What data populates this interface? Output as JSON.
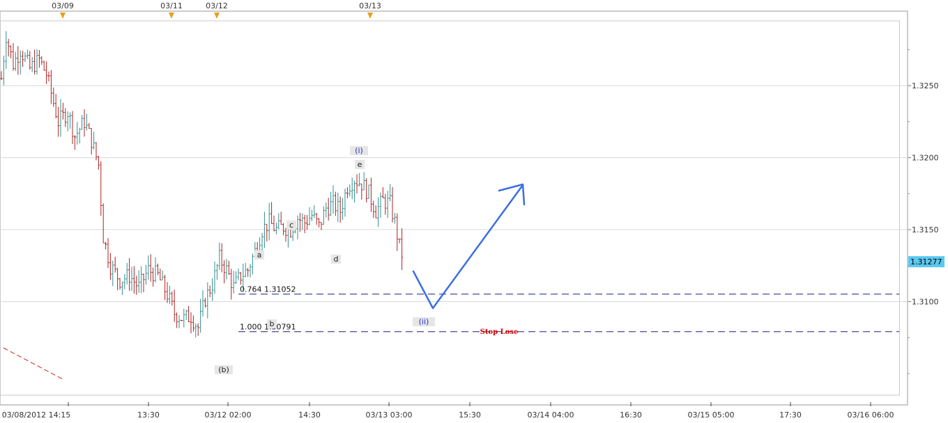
{
  "chart_data": {
    "type": "ohlc",
    "y_axis": {
      "ylim": [
        1.3035,
        1.3295
      ],
      "ticks": [
        1.31,
        1.315,
        1.32,
        1.325
      ],
      "tick_labels": [
        "1.3100",
        "1.3150",
        "1.3200",
        "1.3250"
      ]
    },
    "x_axis": {
      "tick_labels": [
        "03/08/2012 14:15",
        "13:30",
        "03/12 02:00",
        "14:30",
        "03/13 03:00",
        "15:30",
        "03/14 04:00",
        "16:30",
        "03/15 05:00",
        "17:30",
        "03/16 06:00"
      ]
    },
    "session_markers": [
      "03/09",
      "03/11",
      "03/12",
      "03/13"
    ],
    "current_price": {
      "value": 1.31277,
      "label": "1.31277"
    },
    "price_path": [
      [
        0,
        1.3255
      ],
      [
        2,
        1.3285
      ],
      [
        5,
        1.3265
      ],
      [
        8,
        1.3275
      ],
      [
        12,
        1.3262
      ],
      [
        16,
        1.3268
      ],
      [
        19,
        1.3258
      ],
      [
        24,
        1.3225
      ],
      [
        28,
        1.3232
      ],
      [
        31,
        1.3215
      ],
      [
        35,
        1.3225
      ],
      [
        38,
        1.3212
      ],
      [
        41,
        1.3195
      ],
      [
        43,
        1.3145
      ],
      [
        46,
        1.3125
      ],
      [
        50,
        1.3115
      ],
      [
        54,
        1.3118
      ],
      [
        58,
        1.311
      ],
      [
        62,
        1.3122
      ],
      [
        66,
        1.3118
      ],
      [
        70,
        1.3105
      ],
      [
        73,
        1.3092
      ],
      [
        77,
        1.3088
      ],
      [
        80,
        1.309
      ],
      [
        83,
        1.3082
      ],
      [
        86,
        1.3102
      ],
      [
        89,
        1.3112
      ],
      [
        92,
        1.313
      ],
      [
        95,
        1.3122
      ],
      [
        98,
        1.311
      ],
      [
        101,
        1.3118
      ],
      [
        104,
        1.3122
      ],
      [
        107,
        1.3135
      ],
      [
        110,
        1.315
      ],
      [
        113,
        1.3155
      ],
      [
        116,
        1.315
      ],
      [
        119,
        1.3152
      ],
      [
        122,
        1.315
      ],
      [
        125,
        1.3158
      ],
      [
        128,
        1.3155
      ],
      [
        131,
        1.316
      ],
      [
        134,
        1.3152
      ],
      [
        137,
        1.3165
      ],
      [
        140,
        1.3168
      ],
      [
        143,
        1.3163
      ],
      [
        146,
        1.318
      ],
      [
        149,
        1.3185
      ],
      [
        152,
        1.3182
      ],
      [
        155,
        1.3175
      ],
      [
        158,
        1.3163
      ],
      [
        161,
        1.317
      ],
      [
        164,
        1.3168
      ],
      [
        166,
        1.3155
      ],
      [
        168,
        1.3138
      ],
      [
        170,
        1.3128
      ]
    ],
    "annotations": {
      "waves": [
        "(i)",
        "e",
        "c",
        "a",
        "d",
        "b",
        "(b)",
        "(ii)"
      ],
      "fib_levels": [
        {
          "label": "0.764 1.31052",
          "value": 1.31052
        },
        {
          "label": "1.000 1.30791",
          "value": 1.30791
        }
      ],
      "stop_label": "Stop Lose",
      "projection": [
        [
          1.3128
        ],
        [
          1.3105
        ],
        [
          1.3185
        ]
      ]
    },
    "colors": {
      "up": "#2f8f8f",
      "down": "#b02020",
      "grid": "#d8d8d8",
      "projection": "#3b6fe0",
      "fib_line": "#1a1a7a",
      "price_tag": "#5bc8f0"
    }
  }
}
